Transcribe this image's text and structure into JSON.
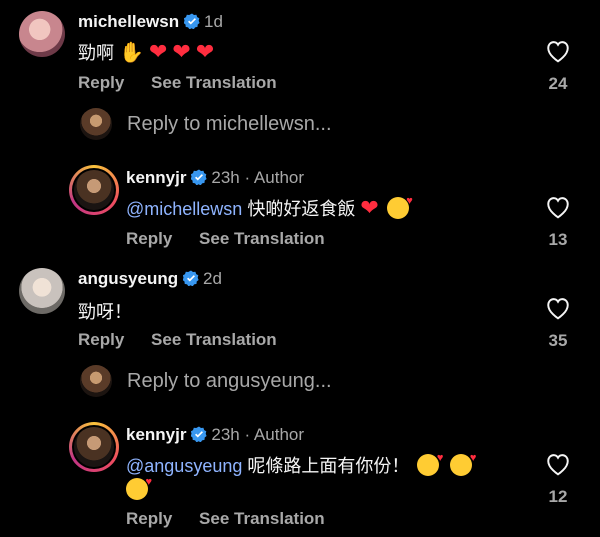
{
  "comments": [
    {
      "username": "michellewsn",
      "time": "1d",
      "text": "勁啊",
      "emojis": [
        "clapping-hands",
        "red-heart",
        "red-heart",
        "red-heart"
      ],
      "actions": [
        "Reply",
        "See Translation"
      ],
      "likes": "24",
      "reply_prompt": "Reply to michellewsn..."
    },
    {
      "username": "kennyjr",
      "time": "23h · Author",
      "mention": "@michellewsn",
      "text": " 快啲好返食飯",
      "emojis": [
        "red-heart",
        "kissing-face"
      ],
      "actions": [
        "Reply",
        "See Translation"
      ],
      "likes": "13"
    },
    {
      "username": "angusyeung",
      "time": "2d",
      "text": "勁呀！",
      "actions": [
        "Reply",
        "See Translation"
      ],
      "likes": "35",
      "reply_prompt": "Reply to angusyeung..."
    },
    {
      "username": "kennyjr",
      "time": "23h · Author",
      "mention": "@angusyeung",
      "text": " 呢條路上面有你份！",
      "emojis": [
        "kissing-face",
        "kissing-face",
        "kissing-face"
      ],
      "actions": [
        "Reply",
        "See Translation"
      ],
      "likes": "12"
    }
  ],
  "colors": {
    "background": "#000000",
    "text": "#f5f5f5",
    "secondary": "#a8a8a8",
    "mention": "#8fb4ff",
    "verified": "#3897f0",
    "heart_emoji": "#ff2d3f"
  }
}
